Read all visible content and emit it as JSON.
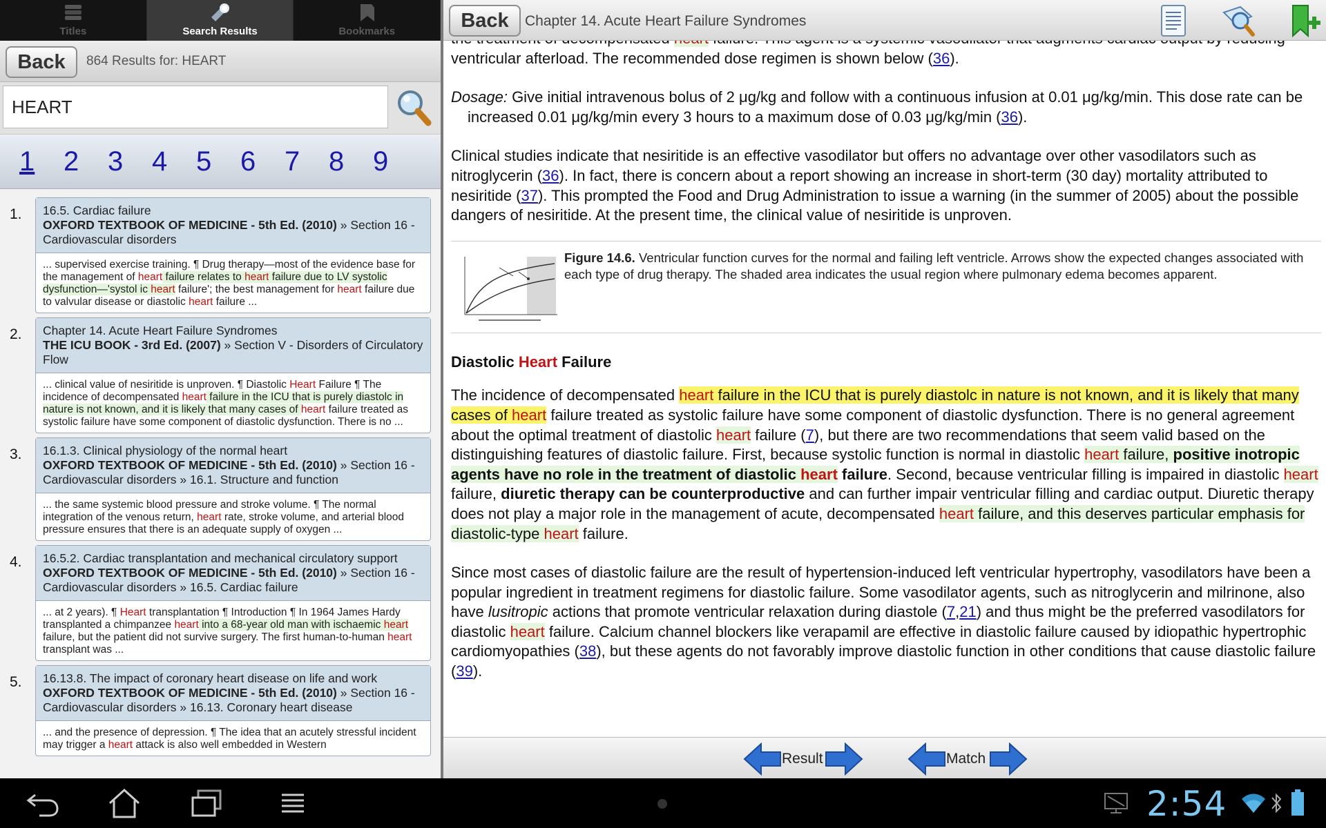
{
  "left": {
    "tabs": [
      {
        "label": "Titles",
        "icon": "books-icon",
        "active": false
      },
      {
        "label": "Search Results",
        "icon": "flashlight-icon",
        "active": true
      },
      {
        "label": "Bookmarks",
        "icon": "bookmark-icon",
        "active": false
      }
    ],
    "back_label": "Back",
    "results_count": "864 Results for: HEART",
    "search_value": "HEART",
    "pages": [
      "1",
      "2",
      "3",
      "4",
      "5",
      "6",
      "7",
      "8",
      "9"
    ],
    "current_page": "1",
    "results": [
      {
        "num": "1.",
        "title": "16.5. Cardiac failure",
        "source": "OXFORD TEXTBOOK OF MEDICINE - 5th Ed. (2010)",
        "path": " » Section 16 - Cardiovascular disorders"
      },
      {
        "num": "2.",
        "title": "Chapter 14. Acute Heart Failure Syndromes",
        "source": "THE ICU BOOK - 3rd Ed. (2007)",
        "path": " » Section V - Disorders of Circulatory Flow"
      },
      {
        "num": "3.",
        "title": "16.1.3. Clinical physiology of the normal heart",
        "source": "OXFORD TEXTBOOK OF MEDICINE - 5th Ed. (2010)",
        "path": " » Section 16 - Cardiovascular disorders » 16.1. Structure and function"
      },
      {
        "num": "4.",
        "title": "16.5.2. Cardiac transplantation and mechanical circulatory support",
        "source": "OXFORD TEXTBOOK OF MEDICINE - 5th Ed. (2010)",
        "path": " » Section 16 - Cardiovascular disorders » 16.5. Cardiac failure"
      },
      {
        "num": "5.",
        "title": "16.13.8. The impact of coronary heart disease on life and work",
        "source": "OXFORD TEXTBOOK OF MEDICINE - 5th Ed. (2010)",
        "path": " » Section 16 - Cardiovascular disorders » 16.13. Coronary heart disease"
      }
    ],
    "snippets": {
      "r1a": "... supervised exercise training. ¶ Drug therapy—most of the evidence base for the management of ",
      "r1b": "heart",
      "r1c": " failure relates to ",
      "r1d": "heart",
      "r1e": " failure due to LV systolic dysfunction—'systol ic ",
      "r1f": "heart",
      "r1g": " failure'; the best management for ",
      "r1h": "heart",
      "r1i": " failure due to valvular disease or diastolic ",
      "r1j": "heart",
      "r1k": " failure ...",
      "r2a": "... clinical value of nesiritide is unproven. ¶ Diastolic ",
      "r2b": "Heart",
      "r2c": " Failure ¶ The incidence of decompensated ",
      "r2d": "heart",
      "r2e": " failure in the ICU that is purely diastolc in nature is not known, and it is likely that many cases of ",
      "r2f": "heart",
      "r2g": " failure treated as systolic failure have some component of diastolic dysfunction. There is no ...",
      "r3a": "... the same systemic blood pressure and stroke volume. ¶ The normal integration of the venous return, ",
      "r3b": "heart",
      "r3c": " rate, stroke volume, and arterial blood pressure ensures that there is an adequate supply of oxygen ...",
      "r4a": "... at 2 years). ¶ ",
      "r4b": "Heart",
      "r4c": " transplantation ¶ Introduction ¶ In 1964 James Hardy transplanted a chimpanzee ",
      "r4d": "heart",
      "r4e": " into a 68-year old man with ischaemic ",
      "r4f": "heart",
      "r4g": " failure, but the patient did not survive surgery. The first human-to-human ",
      "r4h": "heart",
      "r4i": " transplant was ...",
      "r5a": "... and the presence of depression. ¶ The idea that an acutely stressful incident may trigger a ",
      "r5b": "heart",
      "r5c": " attack is also well embedded in Western"
    }
  },
  "right": {
    "back_label": "Back",
    "chapter_title": "Chapter 14. Acute Heart Failure Syndromes",
    "toolbar_icons": [
      "table-of-contents-icon",
      "search-in-book-icon",
      "add-bookmark-icon"
    ],
    "p0": {
      "a": "the treatment of decompensated ",
      "b": "heart",
      "c": " failure. This agent is a systemic vasodilator that augments cardiac output by reducing ventricular afterload. The recommended dose regimen is shown below (",
      "ref": "36",
      "d": ")."
    },
    "dosage": {
      "label": "Dosage:",
      "a": " Give initial intravenous bolus of 2 μg/kg and follow with a continuous infusion at 0.01 μg/kg/min. This dose rate can be increased 0.01 μg/kg/min every 3 hours to a maximum dose of 0.03 μg/kg/min (",
      "ref": "36",
      "b": ")."
    },
    "p2": {
      "a": "Clinical studies indicate that nesiritide is an effective vasodilator but offers no advantage over other vasodilators such as nitroglycerin (",
      "ref1": "36",
      "b": "). In fact, there is concern about a report showing an increase in short-term (30 day) mortality attributed to nesiritide (",
      "ref2": "37",
      "c": "). This prompted the Food and Drug Administration to issue a warning (in the summer of 2005) about the possible dangers of nesiritide. At the present time, the clinical value of nesiritide is unproven."
    },
    "figure": {
      "label": "Figure 14.6.",
      "caption": " Ventricular function curves for the normal and failing left ventricle. Arrows show the expected changes associated with each type of drug therapy. The shaded area indicates the usual region where pulmonary edema becomes apparent."
    },
    "heading": {
      "a": "Diastolic ",
      "b": "Heart",
      "c": " Failure"
    },
    "p3": {
      "a": "The incidence of decompensated ",
      "b": "heart",
      "c": " failure in the ICU that is purely diastolc in nature is not known, and it is likely that many cases of ",
      "d": "heart",
      "e": " failure treated as systolic failure have some component of diastolic dysfunction. There is no general agreement about the optimal treatment of diastolic ",
      "f": "heart",
      "g": " failure (",
      "ref1": "7",
      "h": "), but there are two recommendations that seem valid based on the distinguishing features of diastolic failure. First, because systolic function is normal in diastolic ",
      "i": "heart",
      "j": " failure, ",
      "k": "positive inotropic agents have no role in the treatment of diastolic ",
      "l": "heart",
      "m": " failure",
      "n": ". Second, because ventricular filling is impaired in diastolic ",
      "o": "heart",
      "p": " failure, ",
      "q": "diuretic therapy can be counterproductive",
      "r": " and can further impair ventricular filling and cardiac output. Diuretic therapy does not play a major role in the management of acute, decompensated ",
      "s": "heart",
      "t": " failure, and this deserves particular emphasis for diastolic-type ",
      "u": "heart",
      "v": " failure."
    },
    "p4": {
      "a": "Since most cases of diastolic failure are the result of hypertension-induced left ventricular hypertrophy, vasodilators have been a popular ingredient in treatment regimens for diastolic failure. Some vasodilator agents, such as nitroglycerin and milrinone, also have ",
      "b": "lusitropic",
      "c": " actions that promote ventricular relaxation during diastole (",
      "ref1": "7",
      "comma": ",",
      "ref2": "21",
      "d": ") and thus might be the preferred vasodilators for diastolic ",
      "e": "heart",
      "f": " failure. Calcium channel blockers like verapamil are effective in diastolic failure caused by idiopathic hypertrophic cardiomyopathies (",
      "ref3": "38",
      "g": "), but these agents do not favorably improve diastolic function in other conditions that cause diastolic failure (",
      "ref4": "39",
      "h": ")."
    },
    "bottom": {
      "result_label": "Result",
      "match_label": "Match"
    }
  },
  "system": {
    "time": "2:54",
    "nav_icons": [
      "back-icon",
      "home-icon",
      "recent-apps-icon",
      "menu-icon"
    ],
    "status_icons": [
      "debug-icon",
      "wifi-icon",
      "bluetooth-icon",
      "battery-icon"
    ]
  },
  "colors": {
    "highlight_red": "#c01414",
    "highlight_yellow": "#fbf46a",
    "highlight_green": "#e4f6de",
    "link_blue": "#1a1aa6",
    "clock_blue": "#7ec8f0"
  }
}
